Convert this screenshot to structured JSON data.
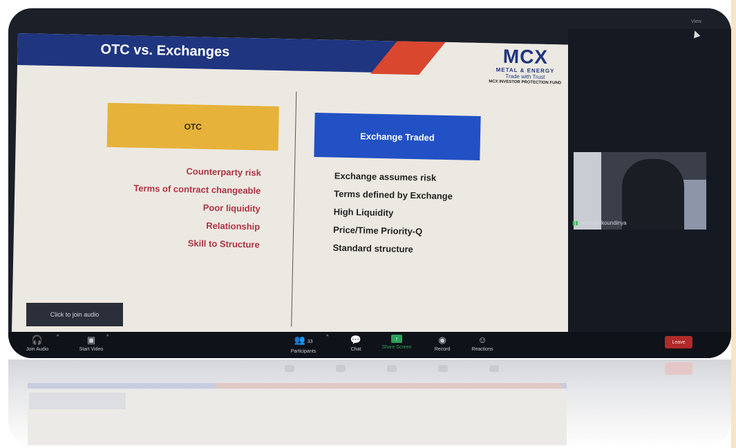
{
  "slide": {
    "title": "OTC vs. Exchanges",
    "logo": {
      "mark": "MCX",
      "sub": "METAL & ENERGY",
      "tagline": "Trade with Trust",
      "fund": "MCX INVESTOR PROTECTION FUND"
    },
    "otc": {
      "heading": "OTC",
      "items": [
        "Counterparty risk",
        "Terms of contract changeable",
        "Poor liquidity",
        "Relationship",
        "Skill to Structure"
      ]
    },
    "exchange": {
      "heading": "Exchange Traded",
      "items": [
        "Exchange assumes risk",
        "Terms defined by Exchange",
        "High Liquidity",
        "Price/Time Priority-Q",
        "Standard structure"
      ]
    },
    "colors": {
      "band": "#1f3580",
      "accent_red": "#d9472f",
      "otc_box": "#e6b23a",
      "exchange_box": "#2151c4",
      "otc_text": "#b03343"
    }
  },
  "meeting": {
    "join_audio_popup": "Click to join audio",
    "panel_label": "View",
    "participant_name": "shrikant koundinya"
  },
  "toolbar": {
    "join_audio": {
      "label": "Join Audio",
      "icon": "headphones-icon"
    },
    "start_video": {
      "label": "Start Video",
      "icon": "video-off-icon"
    },
    "participants": {
      "label": "Participants",
      "count": "33",
      "icon": "participants-icon"
    },
    "chat": {
      "label": "Chat",
      "icon": "chat-icon"
    },
    "share_screen": {
      "label": "Share Screen",
      "icon": "share-screen-icon"
    },
    "record": {
      "label": "Record",
      "icon": "record-icon"
    },
    "reactions": {
      "label": "Reactions",
      "icon": "reactions-icon"
    },
    "leave": {
      "label": "Leave"
    }
  }
}
